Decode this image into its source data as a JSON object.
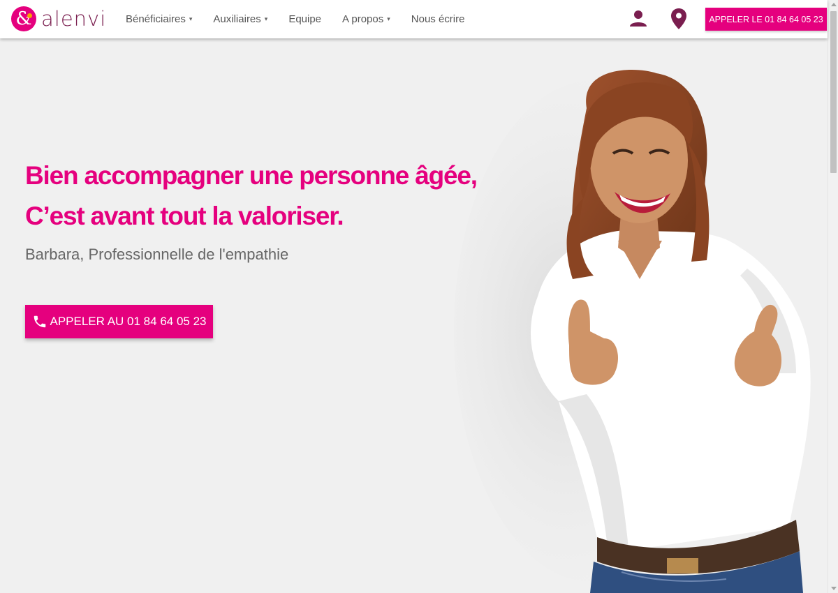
{
  "brand": {
    "name": "alenvi",
    "logo_glyph": "&",
    "primary_color": "#e5007e",
    "dark_color": "#7a1e4f"
  },
  "nav": {
    "items": [
      {
        "label": "Bénéficiaires",
        "has_dropdown": true
      },
      {
        "label": "Auxiliaires",
        "has_dropdown": true
      },
      {
        "label": "Equipe",
        "has_dropdown": false
      },
      {
        "label": "A propos",
        "has_dropdown": true
      },
      {
        "label": "Nous écrire",
        "has_dropdown": false
      }
    ],
    "caret": "▾"
  },
  "header": {
    "account_icon": "user-icon",
    "location_icon": "map-pin-icon",
    "cta_label": "APPELER LE 01 84 64 05 23"
  },
  "hero": {
    "title_line1": "Bien accompagner une personne âgée,",
    "title_line2": "C’est avant tout la valoriser.",
    "subtitle": "Barbara, Professionnelle de l'empathie",
    "cta_label": "APPELER AU 01 84 64 05 23",
    "cta_icon": "phone-icon",
    "photo": "smiling-woman-pointing-photo"
  }
}
